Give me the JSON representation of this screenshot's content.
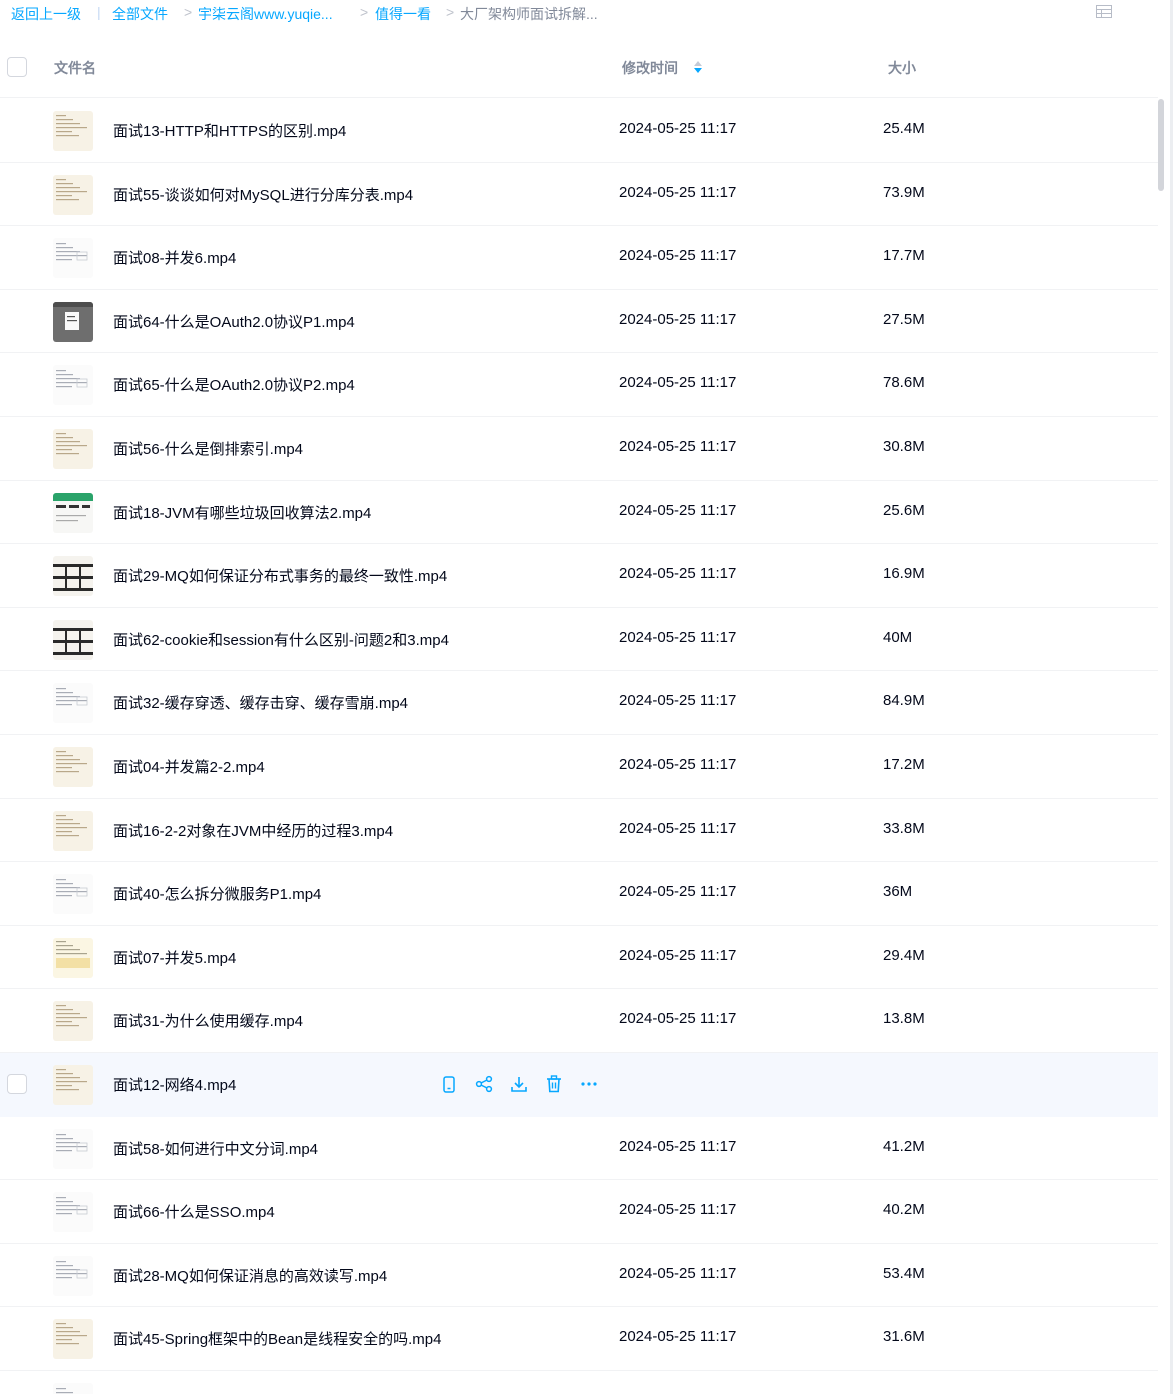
{
  "breadcrumb": {
    "back": "返回上一级",
    "separator": "|",
    "items": [
      "全部文件",
      "宇柒云阁www.yuqie...",
      "值得一看"
    ],
    "current": "大厂架构师面试拆解..."
  },
  "header": {
    "name": "文件名",
    "time": "修改时间",
    "size": "大小"
  },
  "accent_color": "#06a7ff",
  "files": [
    {
      "name": "面试13-HTTP和HTTPS的区别.mp4",
      "time": "2024-05-25 11:17",
      "size": "25.4M",
      "thumb": "doc-beige"
    },
    {
      "name": "面试55-谈谈如何对MySQL进行分库分表.mp4",
      "time": "2024-05-25 11:17",
      "size": "73.9M",
      "thumb": "doc-beige"
    },
    {
      "name": "面试08-并发6.mp4",
      "time": "2024-05-25 11:17",
      "size": "17.7M",
      "thumb": "doc-white"
    },
    {
      "name": "面试64-什么是OAuth2.0协议P1.mp4",
      "time": "2024-05-25 11:17",
      "size": "27.5M",
      "thumb": "dark-gray"
    },
    {
      "name": "面试65-什么是OAuth2.0协议P2.mp4",
      "time": "2024-05-25 11:17",
      "size": "78.6M",
      "thumb": "doc-white"
    },
    {
      "name": "面试56-什么是倒排索引.mp4",
      "time": "2024-05-25 11:17",
      "size": "30.8M",
      "thumb": "doc-beige"
    },
    {
      "name": "面试18-JVM有哪些垃圾回收算法2.mp4",
      "time": "2024-05-25 11:17",
      "size": "25.6M",
      "thumb": "green-table"
    },
    {
      "name": "面试29-MQ如何保证分布式事务的最终一致性.mp4",
      "time": "2024-05-25 11:17",
      "size": "16.9M",
      "thumb": "dark-table"
    },
    {
      "name": "面试62-cookie和session有什么区别-问题2和3.mp4",
      "time": "2024-05-25 11:17",
      "size": "40M",
      "thumb": "dark-table"
    },
    {
      "name": "面试32-缓存穿透、缓存击穿、缓存雪崩.mp4",
      "time": "2024-05-25 11:17",
      "size": "84.9M",
      "thumb": "doc-white"
    },
    {
      "name": "面试04-并发篇2-2.mp4",
      "time": "2024-05-25 11:17",
      "size": "17.2M",
      "thumb": "doc-beige"
    },
    {
      "name": "面试16-2-2对象在JVM中经历的过程3.mp4",
      "time": "2024-05-25 11:17",
      "size": "33.8M",
      "thumb": "doc-beige"
    },
    {
      "name": "面试40-怎么拆分微服务P1.mp4",
      "time": "2024-05-25 11:17",
      "size": "36M",
      "thumb": "doc-white"
    },
    {
      "name": "面试07-并发5.mp4",
      "time": "2024-05-25 11:17",
      "size": "29.4M",
      "thumb": "doc-yellow"
    },
    {
      "name": "面试31-为什么使用缓存.mp4",
      "time": "2024-05-25 11:17",
      "size": "13.8M",
      "thumb": "doc-beige"
    },
    {
      "name": "面试12-网络4.mp4",
      "time": "",
      "size": "",
      "thumb": "doc-beige",
      "hover": true
    },
    {
      "name": "面试58-如何进行中文分词.mp4",
      "time": "2024-05-25 11:17",
      "size": "41.2M",
      "thumb": "doc-white"
    },
    {
      "name": "面试66-什么是SSO.mp4",
      "time": "2024-05-25 11:17",
      "size": "40.2M",
      "thumb": "doc-white"
    },
    {
      "name": "面试28-MQ如何保证消息的高效读写.mp4",
      "time": "2024-05-25 11:17",
      "size": "53.4M",
      "thumb": "doc-white"
    },
    {
      "name": "面试45-Spring框架中的Bean是线程安全的吗.mp4",
      "time": "2024-05-25 11:17",
      "size": "31.6M",
      "thumb": "doc-beige"
    },
    {
      "name": "",
      "time": "",
      "size": "",
      "thumb": "doc-white"
    }
  ],
  "row_actions": [
    "phone-icon",
    "share-icon",
    "download-icon",
    "delete-icon",
    "more-icon"
  ]
}
